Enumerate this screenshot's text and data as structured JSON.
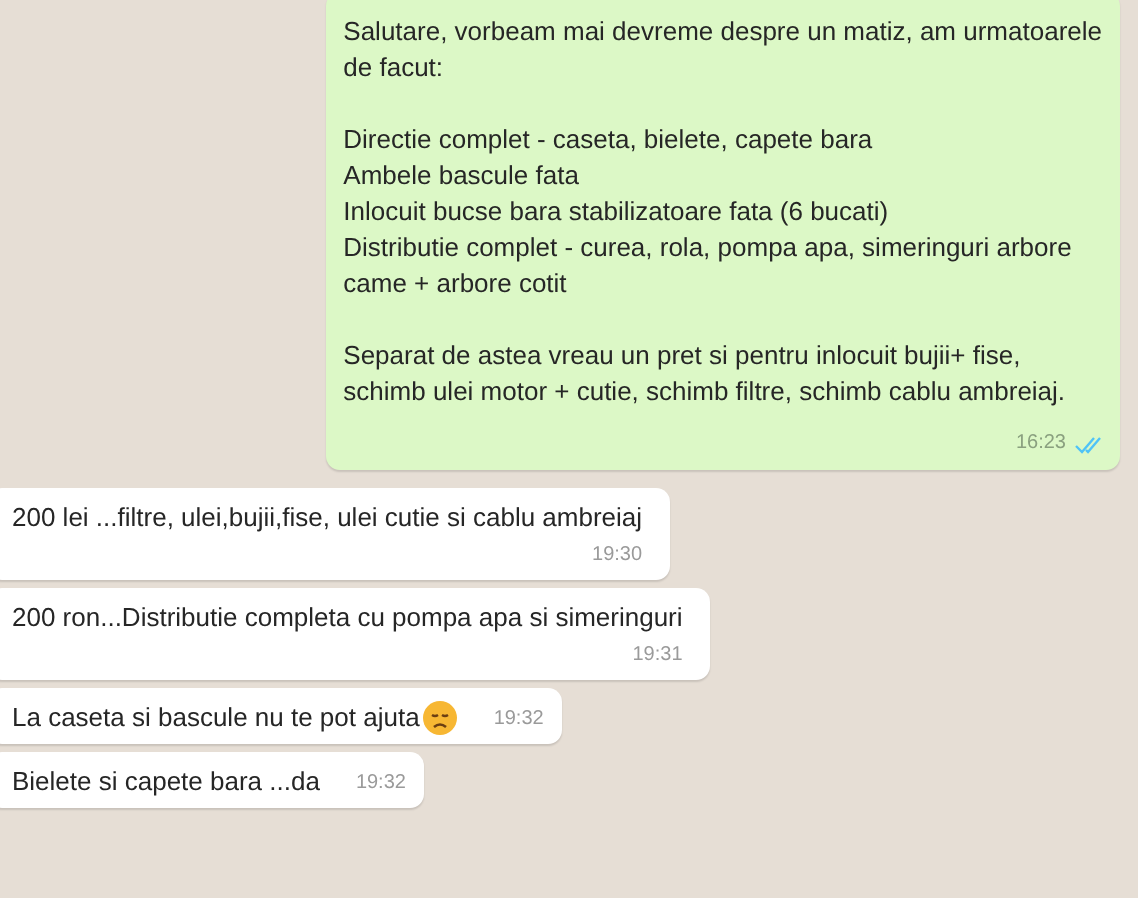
{
  "messages": [
    {
      "kind": "outgoing",
      "paragraphs": [
        "Salutare, vorbeam mai devreme despre un matiz, am urmatoarele\nde facut:",
        "Directie complet - caseta, bielete, capete bara\nAmbele bascule fata\nInlocuit bucse bara stabilizatoare fata (6 bucati)\nDistributie complet - curea, rola, pompa apa, simeringuri arbore\ncame + arbore cotit",
        "Separat de astea vreau un pret si pentru inlocuit bujii+ fise,\nschimb ulei motor + cutie, schimb filtre, schimb cablu ambreiaj."
      ],
      "time": "16:23",
      "read": true
    },
    {
      "kind": "incoming",
      "paragraphs": [
        "200 lei ...filtre, ulei,bujii,fise, ulei cutie si cablu ambreiaj"
      ],
      "time": "19:30",
      "emoji": false
    },
    {
      "kind": "incoming",
      "paragraphs": [
        "200 ron...Distributie completa cu pompa apa si simeringuri"
      ],
      "time": "19:31",
      "emoji": false
    },
    {
      "kind": "incoming",
      "paragraphs": [
        "La caseta si bascule nu te pot ajuta"
      ],
      "time": "19:32",
      "emoji": true
    },
    {
      "kind": "incoming",
      "paragraphs": [
        "Bielete si capete bara ...da"
      ],
      "time": "19:32",
      "emoji": false
    }
  ]
}
